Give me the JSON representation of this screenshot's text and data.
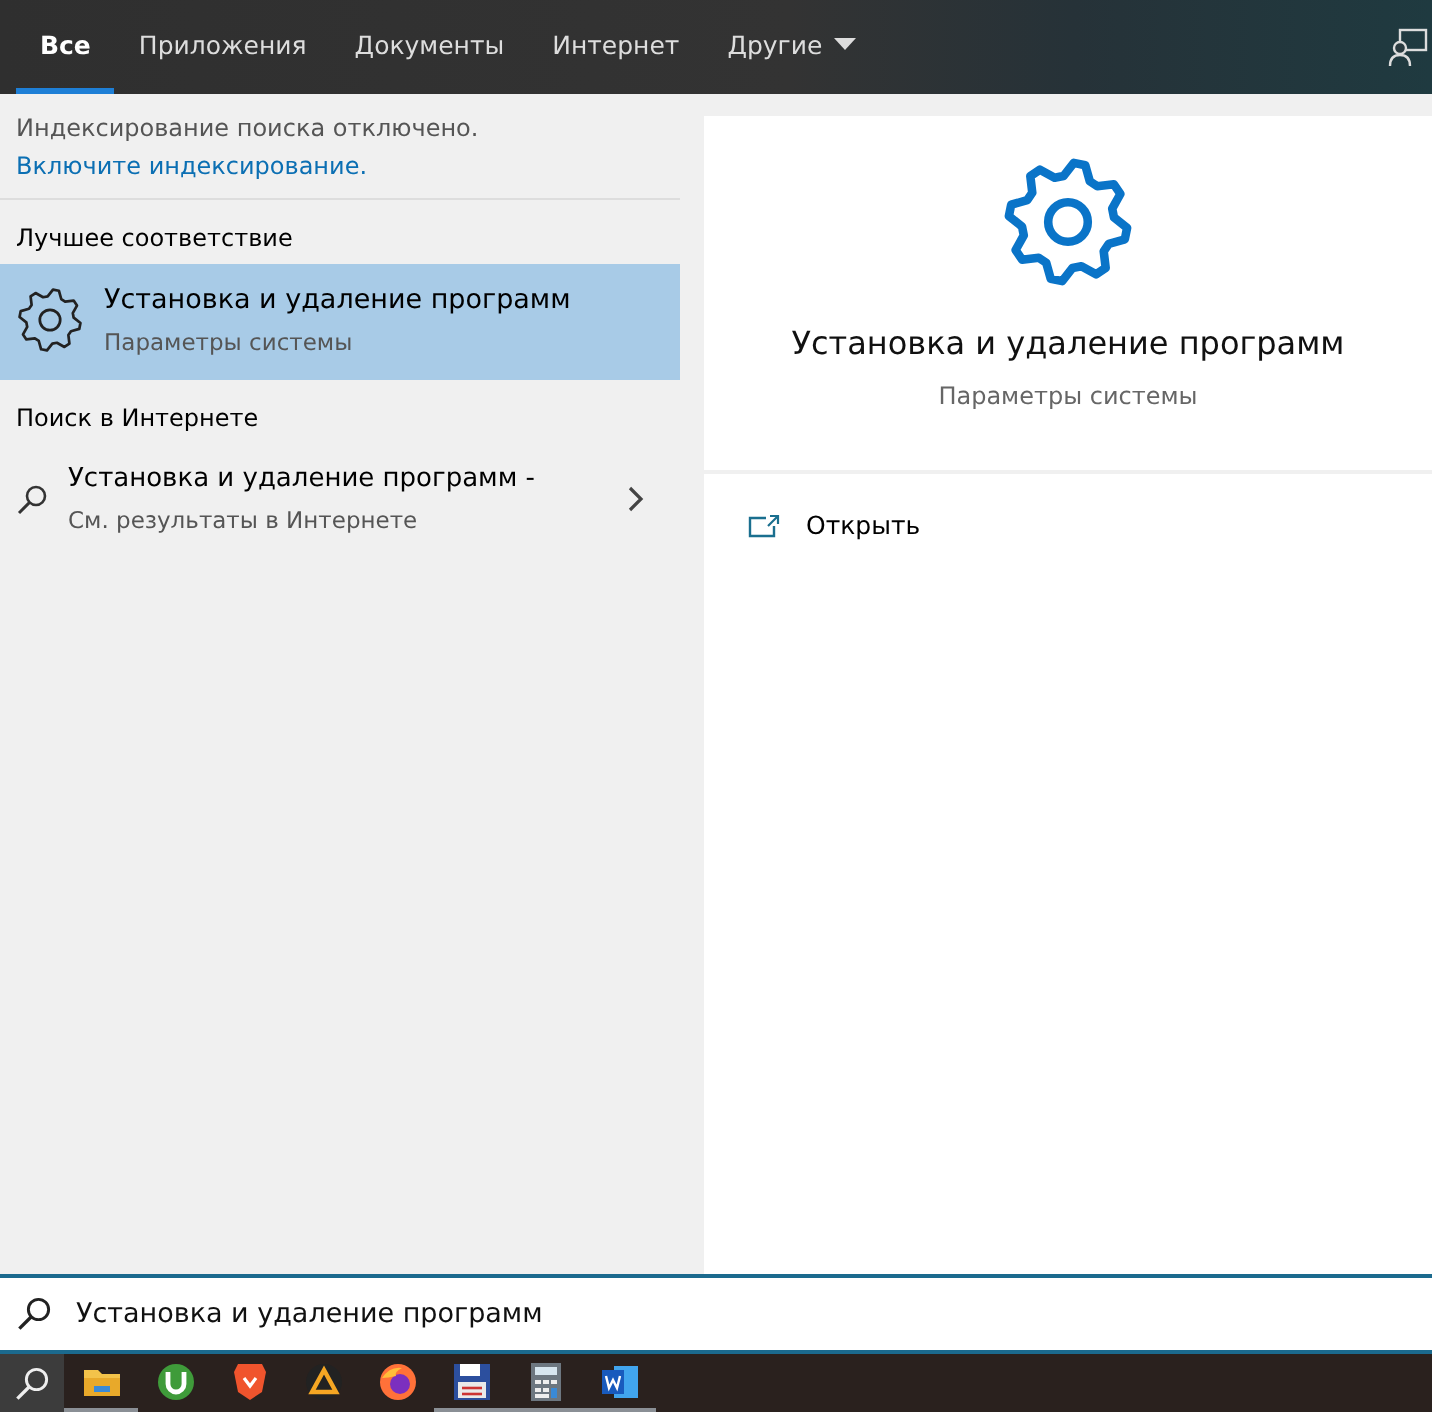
{
  "tabs": [
    {
      "label": "Все",
      "selected": true,
      "kind": "plain"
    },
    {
      "label": "Приложения",
      "selected": false,
      "kind": "plain"
    },
    {
      "label": "Документы",
      "selected": false,
      "kind": "plain"
    },
    {
      "label": "Интернет",
      "selected": false,
      "kind": "plain"
    },
    {
      "label": "Другие",
      "selected": false,
      "kind": "dropdown"
    }
  ],
  "notice": {
    "text": "Индексирование поиска отключено.",
    "link": "Включите индексирование."
  },
  "sections": [
    {
      "heading": "Лучшее соответствие",
      "items": [
        {
          "kind": "app",
          "title": "Установка и удаление программ",
          "subtitle": "Параметры системы",
          "selected": true
        }
      ]
    },
    {
      "heading": "Поиск в Интернете",
      "items": [
        {
          "kind": "web",
          "title": "Установка и удаление программ -",
          "subtitle": "См. результаты в Интернете",
          "selected": false
        }
      ]
    }
  ],
  "detail": {
    "title": "Установка и удаление программ",
    "subtitle": "Параметры системы",
    "actions": [
      {
        "label": "Открыть"
      }
    ]
  },
  "search": {
    "value": "Установка и удаление программ"
  },
  "taskbar": {
    "apps": [
      {
        "kind": "folder",
        "running": true
      },
      {
        "kind": "torrent",
        "running": false
      },
      {
        "kind": "shield",
        "running": false
      },
      {
        "kind": "triangle",
        "running": false
      },
      {
        "kind": "globe",
        "running": false
      },
      {
        "kind": "disk",
        "running": true
      },
      {
        "kind": "calculator",
        "running": true
      },
      {
        "kind": "document",
        "running": true
      }
    ]
  }
}
